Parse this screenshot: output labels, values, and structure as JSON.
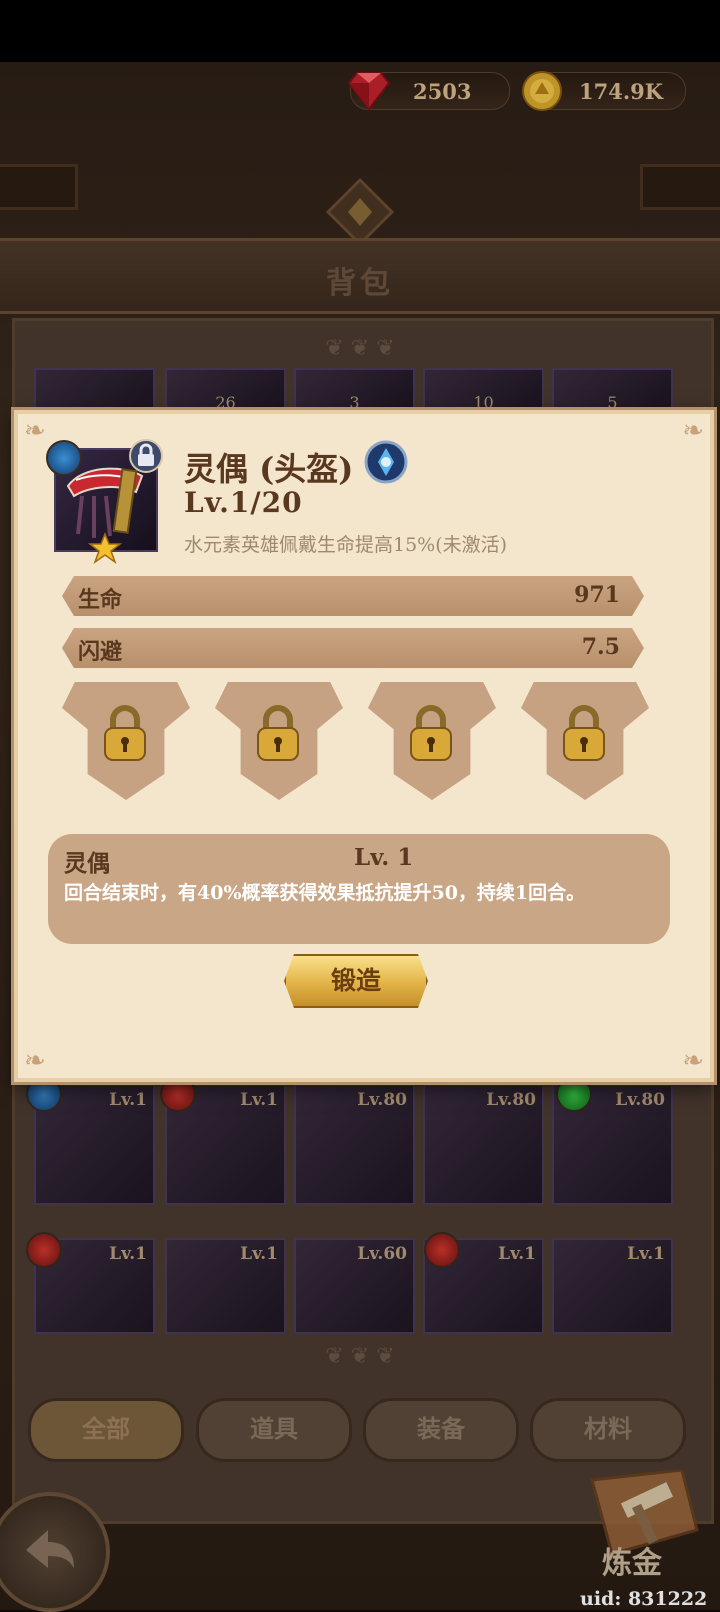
{
  "currencies": {
    "gems": {
      "value": "2503",
      "icon": "ruby-gem-icon"
    },
    "gold": {
      "value": "174.9K",
      "icon": "gold-coin-icon"
    }
  },
  "page_title": "背包",
  "background_grid": {
    "row0_counts": [
      "26",
      "3",
      "10",
      "5"
    ],
    "row1": [
      {
        "level": "Lv.1",
        "gem": "blue"
      },
      {
        "level": "Lv.1",
        "gem": "red"
      },
      {
        "level": "Lv.80",
        "gem": ""
      },
      {
        "level": "Lv.80",
        "gem": ""
      },
      {
        "level": "Lv.80",
        "gem": "green"
      }
    ],
    "row2": [
      {
        "level": "Lv.1",
        "gem": "red"
      },
      {
        "level": "Lv.1",
        "gem": ""
      },
      {
        "level": "Lv.60",
        "gem": ""
      },
      {
        "level": "Lv.1",
        "gem": "red"
      },
      {
        "level": "Lv.1",
        "gem": ""
      }
    ]
  },
  "tabs": [
    "全部",
    "道具",
    "装备",
    "材料"
  ],
  "active_tab": "全部",
  "item": {
    "name": "灵偶 (头盔)",
    "level": "Lv.1/20",
    "bonus": "水元素英雄佩戴生命提高15%(未激活)",
    "stats": [
      {
        "label": "生命",
        "value": "971"
      },
      {
        "label": "闪避",
        "value": "7.5"
      }
    ],
    "locked_slots": 4
  },
  "skill": {
    "name": "灵偶",
    "level": "Lv. 1",
    "description": "回合结束时，有40%概率获得效果抵抗提升50，持续1回合。"
  },
  "forge_label": "锻造",
  "alchemy_label": "炼金",
  "uid": "uid: 831222",
  "colors": {
    "accent_gold": "#e3b348",
    "parchment": "#f4e6cc",
    "stat_bar": "#b8906c"
  }
}
